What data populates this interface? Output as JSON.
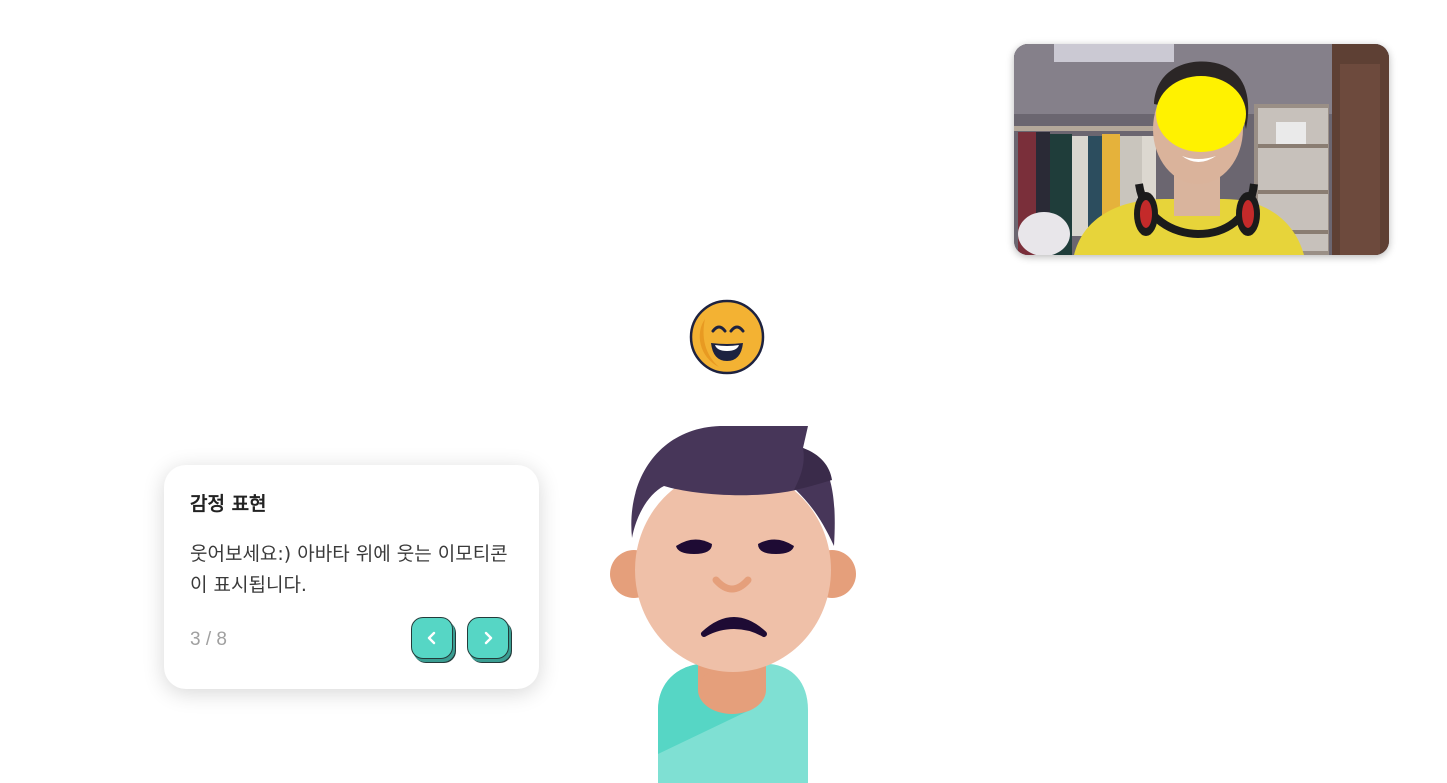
{
  "tutorial": {
    "title": "감정 표현",
    "body": "웃어보세요:) 아바타 위에 웃는 이모티콘이 표시됩니다.",
    "step": "3 / 8",
    "prev_icon": "chevron-left-icon",
    "next_icon": "chevron-right-icon"
  },
  "emoticon": {
    "icon": "laughing-face-icon",
    "color": "#f3b233"
  },
  "colors": {
    "accent": "#56d6c5",
    "hair": "#473659",
    "skin": "#efc0a8",
    "shirt": "#7fe0d3"
  }
}
